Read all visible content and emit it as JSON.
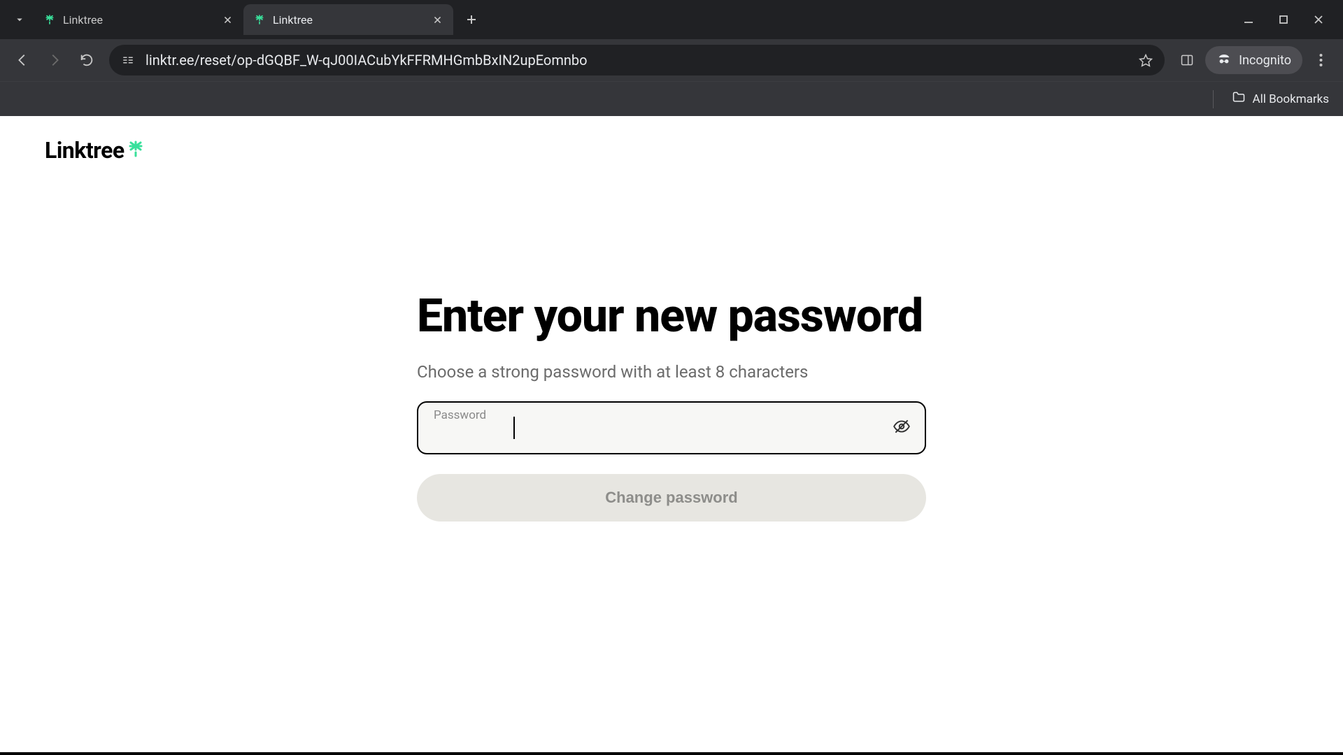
{
  "browser": {
    "tabs": [
      {
        "title": "Linktree",
        "active": false
      },
      {
        "title": "Linktree",
        "active": true
      }
    ],
    "url": "linktr.ee/reset/op-dGQBF_W-qJ00IACubYkFFRMHGmbBxIN2upEomnbo",
    "incognito_label": "Incognito",
    "bookmarks_label": "All Bookmarks"
  },
  "page": {
    "brand": "Linktree",
    "heading": "Enter your new password",
    "subheading": "Choose a strong password with at least 8 characters",
    "password_label": "Password",
    "password_value": "",
    "submit_label": "Change password"
  }
}
